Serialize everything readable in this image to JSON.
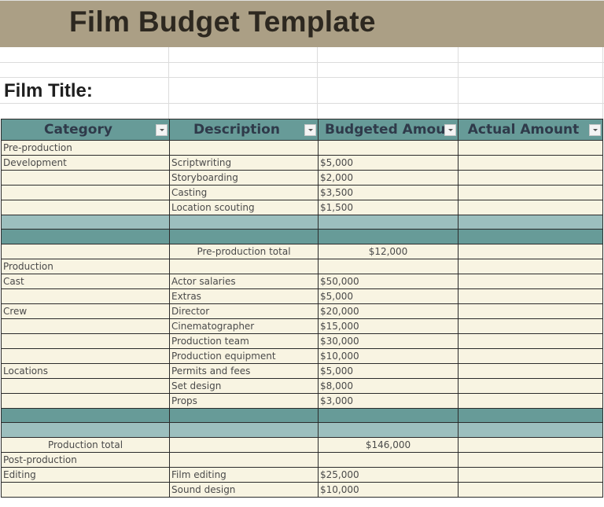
{
  "header": {
    "title": "Film Budget Template",
    "film_title_label": "Film Title:"
  },
  "colors": {
    "banner": "#ab9f85",
    "header_teal": "#679b98",
    "band_light": "#9cbfbe",
    "row_cream": "#f8f4e2"
  },
  "table": {
    "columns": [
      {
        "label": "Category"
      },
      {
        "label": "Description"
      },
      {
        "label": "Budgeted Amoun"
      },
      {
        "label": "Actual Amount"
      }
    ],
    "rows": [
      {
        "type": "data",
        "category": "Pre-production",
        "description": "",
        "budgeted": "",
        "actual": ""
      },
      {
        "type": "data",
        "category": "Development",
        "description": "Scriptwriting",
        "budgeted": "$5,000",
        "actual": ""
      },
      {
        "type": "data",
        "category": "",
        "description": "Storyboarding",
        "budgeted": "$2,000",
        "actual": ""
      },
      {
        "type": "data",
        "category": "",
        "description": "Casting",
        "budgeted": "$3,500",
        "actual": ""
      },
      {
        "type": "data",
        "category": "",
        "description": "Location scouting",
        "budgeted": "$1,500",
        "actual": ""
      },
      {
        "type": "band-light"
      },
      {
        "type": "band-dark"
      },
      {
        "type": "total-desc",
        "category": "",
        "description": "Pre-production total",
        "budgeted": "$12,000",
        "actual": ""
      },
      {
        "type": "data",
        "category": "Production",
        "description": "",
        "budgeted": "",
        "actual": ""
      },
      {
        "type": "data",
        "category": "Cast",
        "description": "Actor salaries",
        "budgeted": "$50,000",
        "actual": ""
      },
      {
        "type": "data",
        "category": "",
        "description": "Extras",
        "budgeted": "$5,000",
        "actual": ""
      },
      {
        "type": "data",
        "category": "Crew",
        "description": "Director",
        "budgeted": "$20,000",
        "actual": ""
      },
      {
        "type": "data",
        "category": "",
        "description": "Cinematographer",
        "budgeted": "$15,000",
        "actual": ""
      },
      {
        "type": "data",
        "category": "",
        "description": "Production team",
        "budgeted": "$30,000",
        "actual": ""
      },
      {
        "type": "data",
        "category": "",
        "description": "Production equipment",
        "budgeted": "$10,000",
        "actual": ""
      },
      {
        "type": "data",
        "category": "Locations",
        "description": "Permits and fees",
        "budgeted": "$5,000",
        "actual": ""
      },
      {
        "type": "data",
        "category": "",
        "description": "Set design",
        "budgeted": "$8,000",
        "actual": ""
      },
      {
        "type": "data",
        "category": "",
        "description": "Props",
        "budgeted": "$3,000",
        "actual": ""
      },
      {
        "type": "band-dark"
      },
      {
        "type": "band-light"
      },
      {
        "type": "total-cat",
        "category": "Production total",
        "description": "",
        "budgeted": "$146,000",
        "actual": ""
      },
      {
        "type": "data",
        "category": "Post-production",
        "description": "",
        "budgeted": "",
        "actual": ""
      },
      {
        "type": "data",
        "category": "Editing",
        "description": "Film editing",
        "budgeted": "$25,000",
        "actual": ""
      },
      {
        "type": "data",
        "category": "",
        "description": "Sound design",
        "budgeted": "$10,000",
        "actual": ""
      }
    ]
  }
}
